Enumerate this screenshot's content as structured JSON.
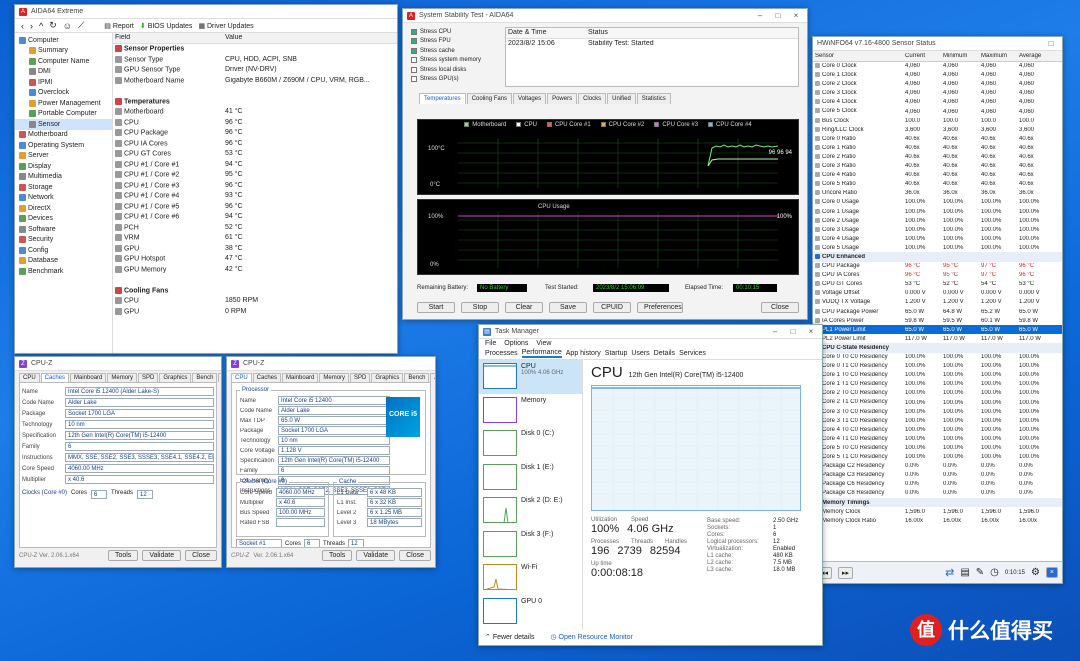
{
  "aida": {
    "title": "AIDA64 Extreme",
    "tree": [
      {
        "label": "Computer",
        "level": 0,
        "icon": "computer-icon"
      },
      {
        "label": "Summary",
        "level": 1,
        "icon": "summary-icon"
      },
      {
        "label": "Computer Name",
        "level": 1,
        "icon": "pc-icon"
      },
      {
        "label": "DMI",
        "level": 1,
        "icon": "dmi-icon"
      },
      {
        "label": "IPMI",
        "level": 1,
        "icon": "ipmi-icon"
      },
      {
        "label": "Overclock",
        "level": 1,
        "icon": "oc-icon"
      },
      {
        "label": "Power Management",
        "level": 1,
        "icon": "power-icon"
      },
      {
        "label": "Portable Computer",
        "level": 1,
        "icon": "laptop-icon"
      },
      {
        "label": "Sensor",
        "level": 1,
        "icon": "sensor-icon",
        "selected": true
      },
      {
        "label": "Motherboard",
        "level": 0,
        "icon": "board-icon"
      },
      {
        "label": "Operating System",
        "level": 0,
        "icon": "os-icon"
      },
      {
        "label": "Server",
        "level": 0,
        "icon": "server-icon"
      },
      {
        "label": "Display",
        "level": 0,
        "icon": "display-icon"
      },
      {
        "label": "Multimedia",
        "level": 0,
        "icon": "media-icon"
      },
      {
        "label": "Storage",
        "level": 0,
        "icon": "storage-icon"
      },
      {
        "label": "Network",
        "level": 0,
        "icon": "network-icon"
      },
      {
        "label": "DirectX",
        "level": 0,
        "icon": "dx-icon"
      },
      {
        "label": "Devices",
        "level": 0,
        "icon": "devices-icon"
      },
      {
        "label": "Software",
        "level": 0,
        "icon": "software-icon"
      },
      {
        "label": "Security",
        "level": 0,
        "icon": "security-icon"
      },
      {
        "label": "Config",
        "level": 0,
        "icon": "config-icon"
      },
      {
        "label": "Database",
        "level": 0,
        "icon": "db-icon"
      },
      {
        "label": "Benchmark",
        "level": 0,
        "icon": "bench-icon"
      }
    ],
    "toolbar": [
      "Report",
      "BIOS Updates",
      "Driver Updates"
    ],
    "columns": [
      "Field",
      "Value"
    ],
    "rows": [
      {
        "field": "Sensor Properties",
        "value": "",
        "head": true
      },
      {
        "field": "Sensor Type",
        "value": "CPU, HDD, ACPI, SNB"
      },
      {
        "field": "GPU Sensor Type",
        "value": "Driver (NV-DRV)"
      },
      {
        "field": "Motherboard Name",
        "value": "Gigabyte B660M / Z690M / CPU, VRM, RGB..."
      },
      {
        "field": "",
        "value": ""
      },
      {
        "field": "Temperatures",
        "value": "",
        "head": true
      },
      {
        "field": "Motherboard",
        "value": "41 °C"
      },
      {
        "field": "CPU",
        "value": "96 °C"
      },
      {
        "field": "CPU Package",
        "value": "96 °C"
      },
      {
        "field": "CPU IA Cores",
        "value": "96 °C"
      },
      {
        "field": "CPU GT Cores",
        "value": "53 °C"
      },
      {
        "field": "CPU #1 / Core #1",
        "value": "94 °C"
      },
      {
        "field": "CPU #1 / Core #2",
        "value": "95 °C"
      },
      {
        "field": "CPU #1 / Core #3",
        "value": "96 °C"
      },
      {
        "field": "CPU #1 / Core #4",
        "value": "93 °C"
      },
      {
        "field": "CPU #1 / Core #5",
        "value": "96 °C"
      },
      {
        "field": "CPU #1 / Core #6",
        "value": "94 °C"
      },
      {
        "field": "PCH",
        "value": "52 °C"
      },
      {
        "field": "VRM",
        "value": "61 °C"
      },
      {
        "field": "GPU",
        "value": "38 °C"
      },
      {
        "field": "GPU Hotspot",
        "value": "47 °C"
      },
      {
        "field": "GPU Memory",
        "value": "42 °C"
      },
      {
        "field": "",
        "value": ""
      },
      {
        "field": "Cooling Fans",
        "value": "",
        "head": true
      },
      {
        "field": "CPU",
        "value": "1850 RPM"
      },
      {
        "field": "GPU",
        "value": "0 RPM"
      }
    ]
  },
  "stability": {
    "title": "System Stability Test - AIDA64",
    "checks": [
      {
        "label": "Stress CPU",
        "on": true
      },
      {
        "label": "Stress FPU",
        "on": true
      },
      {
        "label": "Stress cache",
        "on": true
      },
      {
        "label": "Stress system memory",
        "on": false
      },
      {
        "label": "Stress local disks",
        "on": false
      },
      {
        "label": "Stress GPU(s)",
        "on": false
      }
    ],
    "info_headers": [
      "Date & Time",
      "Status"
    ],
    "info_values": [
      "2023/8/2 15:06",
      "Stability Test: Started"
    ],
    "tabs": [
      "Temperatures",
      "Cooling Fans",
      "Voltages",
      "Powers",
      "Clocks",
      "Unified",
      "Statistics"
    ],
    "legend": [
      "Motherboard",
      "CPU",
      "CPU Core #1",
      "CPU Core #2",
      "CPU Core #3",
      "CPU Core #4"
    ],
    "chart1_top": "100°C",
    "chart1_bottom": "0°C",
    "chart1_readout": "96 96 94",
    "chart2_label": "CPU Usage",
    "chart2_top": "100%",
    "chart2_bottom": "0%",
    "chart2_readout": "100%",
    "bottom_labels": [
      "Remaining Battery:",
      "Test Started:",
      "Elapsed Time:"
    ],
    "bottom_values": [
      "No Battery",
      "2023/8/2 15:06:09",
      "00:10:15"
    ],
    "buttons": [
      "Start",
      "Stop",
      "Clear",
      "Save",
      "CPUID",
      "Preferences",
      "Close"
    ]
  },
  "hwinfo": {
    "title": "HWiNFO64 v7.16-4800 Sensor Status",
    "columns": [
      "Sensor",
      "Current",
      "Minimum",
      "Maximum",
      "Average"
    ],
    "rows": [
      {
        "n": "Core 0 Clock",
        "c": "4,060",
        "mi": "4,060",
        "ma": "4,060",
        "a": "4,060"
      },
      {
        "n": "Core 1 Clock",
        "c": "4,060",
        "mi": "4,060",
        "ma": "4,060",
        "a": "4,060"
      },
      {
        "n": "Core 2 Clock",
        "c": "4,060",
        "mi": "4,060",
        "ma": "4,060",
        "a": "4,060"
      },
      {
        "n": "Core 3 Clock",
        "c": "4,060",
        "mi": "4,060",
        "ma": "4,060",
        "a": "4,060"
      },
      {
        "n": "Core 4 Clock",
        "c": "4,060",
        "mi": "4,060",
        "ma": "4,060",
        "a": "4,060"
      },
      {
        "n": "Core 5 Clock",
        "c": "4,060",
        "mi": "4,060",
        "ma": "4,060",
        "a": "4,060"
      },
      {
        "n": "Bus Clock",
        "c": "100.0",
        "mi": "100.0",
        "ma": "100.0",
        "a": "100.0"
      },
      {
        "n": "Ring/LLC Clock",
        "c": "3,600",
        "mi": "3,600",
        "ma": "3,600",
        "a": "3,600"
      },
      {
        "n": "Core 0 Ratio",
        "c": "40.6x",
        "mi": "40.6x",
        "ma": "40.6x",
        "a": "40.6x"
      },
      {
        "n": "Core 1 Ratio",
        "c": "40.6x",
        "mi": "40.6x",
        "ma": "40.6x",
        "a": "40.6x"
      },
      {
        "n": "Core 2 Ratio",
        "c": "40.6x",
        "mi": "40.6x",
        "ma": "40.6x",
        "a": "40.6x"
      },
      {
        "n": "Core 3 Ratio",
        "c": "40.6x",
        "mi": "40.6x",
        "ma": "40.6x",
        "a": "40.6x"
      },
      {
        "n": "Core 4 Ratio",
        "c": "40.6x",
        "mi": "40.6x",
        "ma": "40.6x",
        "a": "40.6x"
      },
      {
        "n": "Core 5 Ratio",
        "c": "40.6x",
        "mi": "40.6x",
        "ma": "40.6x",
        "a": "40.6x"
      },
      {
        "n": "Uncore Ratio",
        "c": "36.0x",
        "mi": "36.0x",
        "ma": "36.0x",
        "a": "36.0x"
      },
      {
        "n": "Core 0 Usage",
        "c": "100.0%",
        "mi": "100.0%",
        "ma": "100.0%",
        "a": "100.0%"
      },
      {
        "n": "Core 1 Usage",
        "c": "100.0%",
        "mi": "100.0%",
        "ma": "100.0%",
        "a": "100.0%"
      },
      {
        "n": "Core 2 Usage",
        "c": "100.0%",
        "mi": "100.0%",
        "ma": "100.0%",
        "a": "100.0%"
      },
      {
        "n": "Core 3 Usage",
        "c": "100.0%",
        "mi": "100.0%",
        "ma": "100.0%",
        "a": "100.0%"
      },
      {
        "n": "Core 4 Usage",
        "c": "100.0%",
        "mi": "100.0%",
        "ma": "100.0%",
        "a": "100.0%"
      },
      {
        "n": "Core 5 Usage",
        "c": "100.0%",
        "mi": "100.0%",
        "ma": "100.0%",
        "a": "100.0%"
      },
      {
        "n": "CPU Enhanced",
        "c": "",
        "mi": "",
        "ma": "",
        "a": "",
        "head": true
      },
      {
        "n": "CPU Package",
        "c": "96 °C",
        "mi": "95 °C",
        "ma": "97 °C",
        "a": "96 °C",
        "red": true
      },
      {
        "n": "CPU IA Cores",
        "c": "96 °C",
        "mi": "95 °C",
        "ma": "97 °C",
        "a": "96 °C",
        "red": true
      },
      {
        "n": "CPU GT Cores",
        "c": "53 °C",
        "mi": "52 °C",
        "ma": "54 °C",
        "a": "53 °C"
      },
      {
        "n": "Voltage Offset",
        "c": "0.000 V",
        "mi": "0.000 V",
        "ma": "0.000 V",
        "a": "0.000 V"
      },
      {
        "n": "VDDQ TX Voltage",
        "c": "1.200 V",
        "mi": "1.200 V",
        "ma": "1.200 V",
        "a": "1.200 V"
      },
      {
        "n": "CPU Package Power",
        "c": "65.0 W",
        "mi": "64.8 W",
        "ma": "65.2 W",
        "a": "65.0 W"
      },
      {
        "n": "IA Cores Power",
        "c": "59.8 W",
        "mi": "59.5 W",
        "ma": "60.1 W",
        "a": "59.8 W"
      },
      {
        "n": "PL1 Power Limit",
        "c": "65.0 W",
        "mi": "65.0 W",
        "ma": "65.0 W",
        "a": "65.0 W",
        "sel": true
      },
      {
        "n": "PL2 Power Limit",
        "c": "117.0 W",
        "mi": "117.0 W",
        "ma": "117.0 W",
        "a": "117.0 W"
      },
      {
        "n": "CPU C-State Residency",
        "c": "",
        "mi": "",
        "ma": "",
        "a": "",
        "head": true
      },
      {
        "n": "Core 0 T0 C0 Residency",
        "c": "100.0%",
        "mi": "100.0%",
        "ma": "100.0%",
        "a": "100.0%"
      },
      {
        "n": "Core 0 T1 C0 Residency",
        "c": "100.0%",
        "mi": "100.0%",
        "ma": "100.0%",
        "a": "100.0%"
      },
      {
        "n": "Core 1 T0 C0 Residency",
        "c": "100.0%",
        "mi": "100.0%",
        "ma": "100.0%",
        "a": "100.0%"
      },
      {
        "n": "Core 1 T1 C0 Residency",
        "c": "100.0%",
        "mi": "100.0%",
        "ma": "100.0%",
        "a": "100.0%"
      },
      {
        "n": "Core 2 T0 C0 Residency",
        "c": "100.0%",
        "mi": "100.0%",
        "ma": "100.0%",
        "a": "100.0%"
      },
      {
        "n": "Core 2 T1 C0 Residency",
        "c": "100.0%",
        "mi": "100.0%",
        "ma": "100.0%",
        "a": "100.0%"
      },
      {
        "n": "Core 3 T0 C0 Residency",
        "c": "100.0%",
        "mi": "100.0%",
        "ma": "100.0%",
        "a": "100.0%"
      },
      {
        "n": "Core 3 T1 C0 Residency",
        "c": "100.0%",
        "mi": "100.0%",
        "ma": "100.0%",
        "a": "100.0%"
      },
      {
        "n": "Core 4 T0 C0 Residency",
        "c": "100.0%",
        "mi": "100.0%",
        "ma": "100.0%",
        "a": "100.0%"
      },
      {
        "n": "Core 4 T1 C0 Residency",
        "c": "100.0%",
        "mi": "100.0%",
        "ma": "100.0%",
        "a": "100.0%"
      },
      {
        "n": "Core 5 T0 C0 Residency",
        "c": "100.0%",
        "mi": "100.0%",
        "ma": "100.0%",
        "a": "100.0%"
      },
      {
        "n": "Core 5 T1 C0 Residency",
        "c": "100.0%",
        "mi": "100.0%",
        "ma": "100.0%",
        "a": "100.0%"
      },
      {
        "n": "Package C2 Residency",
        "c": "0.0%",
        "mi": "0.0%",
        "ma": "0.0%",
        "a": "0.0%"
      },
      {
        "n": "Package C3 Residency",
        "c": "0.0%",
        "mi": "0.0%",
        "ma": "0.0%",
        "a": "0.0%"
      },
      {
        "n": "Package C6 Residency",
        "c": "0.0%",
        "mi": "0.0%",
        "ma": "0.0%",
        "a": "0.0%"
      },
      {
        "n": "Package C8 Residency",
        "c": "0.0%",
        "mi": "0.0%",
        "ma": "0.0%",
        "a": "0.0%"
      },
      {
        "n": "Memory Timings",
        "c": "",
        "mi": "",
        "ma": "",
        "a": "",
        "head": true
      },
      {
        "n": "Memory Clock",
        "c": "1,596.0",
        "mi": "1,596.0",
        "ma": "1,596.0",
        "a": "1,596.0"
      },
      {
        "n": "Memory Clock Ratio",
        "c": "16.00x",
        "mi": "16.00x",
        "ma": "16.00x",
        "a": "16.00x"
      }
    ],
    "footer_time": "0:10:15"
  },
  "cpuz1": {
    "title": "CPU-Z",
    "tabs": [
      "CPU",
      "Caches",
      "Mainboard",
      "Memory",
      "SPD",
      "Graphics",
      "Bench",
      "About"
    ],
    "active": 1,
    "label_rows": [
      {
        "l": "Name",
        "v": "Intel Core i5 12400 (Alder Lake-S)"
      },
      {
        "l": "Code Name",
        "v": "Alder Lake"
      },
      {
        "l": "Package",
        "v": "Socket 1700 LGA"
      },
      {
        "l": "Technology",
        "v": "10 nm"
      },
      {
        "l": "Specification",
        "v": "12th Gen Intel(R) Core(TM) i5-12400"
      },
      {
        "l": "Family",
        "v": "6"
      },
      {
        "l": "Instructions",
        "v": "MMX, SSE, SSE2, SSE3, SSSE3, SSE4.1, SSE4.2, EM64T, VT-x, AES, AVX, AVX2, FMA3"
      },
      {
        "l": "Core Speed",
        "v": "4060.00 MHz"
      },
      {
        "l": "Multiplier",
        "v": "x 40.6"
      }
    ],
    "legend_clocks": "Clocks (Core #0)",
    "cores_label": "Cores",
    "cores_value": "6",
    "threads_label": "Threads",
    "threads_value": "12",
    "version": "CPU-Z  Ver. 2.06.1.x64",
    "buttons": [
      "Tools",
      "Validate",
      "Close"
    ]
  },
  "cpuz2": {
    "title": "CPU-Z",
    "tabs": [
      "CPU",
      "Caches",
      "Mainboard",
      "Memory",
      "SPD",
      "Graphics",
      "Bench",
      "About"
    ],
    "fields": [
      {
        "l": "Name",
        "v": "Intel Core i5 12400"
      },
      {
        "l": "Code Name",
        "v": "Alder Lake"
      },
      {
        "l": "Max TDP",
        "v": "65.0 W"
      },
      {
        "l": "Package",
        "v": "Socket 1700 LGA"
      },
      {
        "l": "Technology",
        "v": "10 nm"
      },
      {
        "l": "Core Voltage",
        "v": "1.128 V"
      },
      {
        "l": "Specification",
        "v": "12th Gen Intel(R) Core(TM) i5-12400"
      },
      {
        "l": "Family",
        "v": "6"
      },
      {
        "l": "Ext. Family",
        "v": "6"
      },
      {
        "l": "Instructions",
        "v": "MMX, SSE, SSE2, SSE3, SSSE3, SSE4.1, SSE4.2, EM64T, VT-x, AES, AVX, AVX2"
      }
    ],
    "clocks_legend": "Clocks (Core #0)",
    "cache_legend": "Cache",
    "clock_rows": [
      {
        "l": "Core Speed",
        "v": "4060.00 MHz"
      },
      {
        "l": "Multiplier",
        "v": "x 40.6"
      },
      {
        "l": "Bus Speed",
        "v": "100.00 MHz"
      },
      {
        "l": "Rated FSB",
        "v": ""
      }
    ],
    "cache_rows": [
      {
        "l": "L1 Data",
        "v": "6 x 48 KB"
      },
      {
        "l": "L1 Inst.",
        "v": "6 x 32 KB"
      },
      {
        "l": "Level 2",
        "v": "6 x 1.25 MB"
      },
      {
        "l": "Level 3",
        "v": "18 MBytes"
      }
    ],
    "selection": "Socket #1",
    "cores_label": "Cores",
    "cores_value": "6",
    "threads_label": "Threads",
    "threads_value": "12",
    "brand": "CPU-Z",
    "version": "Ver. 2.06.1.x64",
    "badge": "CORE i5",
    "buttons": [
      "Tools",
      "Validate",
      "Close"
    ]
  },
  "taskmgr": {
    "title": "Task Manager",
    "menu": [
      "File",
      "Options",
      "View"
    ],
    "tabs": [
      "Processes",
      "Performance",
      "App history",
      "Startup",
      "Users",
      "Details",
      "Services"
    ],
    "items": [
      {
        "name": "CPU",
        "sub": "100%  4.06 GHz",
        "active": true
      },
      {
        "name": "Memory",
        "sub": ""
      },
      {
        "name": "Disk 0 (C:)",
        "sub": ""
      },
      {
        "name": "Disk 1 (E:)",
        "sub": ""
      },
      {
        "name": "Disk 2 (D: E:)",
        "sub": ""
      },
      {
        "name": "Disk 3 (F:)",
        "sub": ""
      },
      {
        "name": "Wi-Fi",
        "sub": ""
      },
      {
        "name": "GPU 0",
        "sub": ""
      }
    ],
    "head": "CPU",
    "cpu_model": "12th Gen Intel(R) Core(TM) i5-12400",
    "util_label": "Utilization",
    "util": "100%",
    "speed_label": "Speed",
    "speed": "4.06 GHz",
    "proc_label": "Processes",
    "procs": "196",
    "threads_label": "Threads",
    "threads": "2739",
    "handles_label": "Handles",
    "handles": "82594",
    "uptime_label": "Up time",
    "uptime": "0:00:08:18",
    "specs": [
      {
        "l": "Base speed:",
        "v": "2.50 GHz"
      },
      {
        "l": "Sockets:",
        "v": "1"
      },
      {
        "l": "Cores:",
        "v": "6"
      },
      {
        "l": "Logical processors:",
        "v": "12"
      },
      {
        "l": "Virtualization:",
        "v": "Enabled"
      },
      {
        "l": "L1 cache:",
        "v": "480 KB"
      },
      {
        "l": "L2 cache:",
        "v": "7.5 MB"
      },
      {
        "l": "L3 cache:",
        "v": "18.0 MB"
      }
    ],
    "footer_left": "Fewer details",
    "footer_right": "Open Resource Monitor"
  },
  "watermark": "什么值得买"
}
